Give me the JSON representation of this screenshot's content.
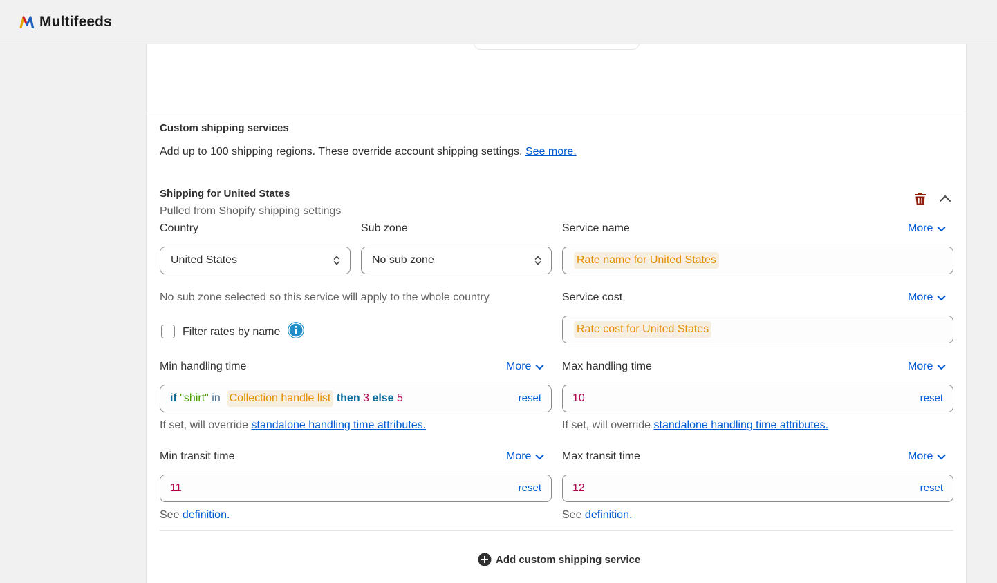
{
  "app": {
    "brand": "Multifeeds"
  },
  "section": {
    "title": "Custom shipping services",
    "description": "Add up to 100 shipping regions. These override account shipping settings.",
    "see_more_link": "See more."
  },
  "service": {
    "title": "Shipping for United States",
    "subtitle": "Pulled from Shopify shipping settings",
    "country": {
      "label": "Country",
      "value": "United States"
    },
    "sub_zone": {
      "label": "Sub zone",
      "value": "No sub zone"
    },
    "sub_zone_note": "No sub zone selected so this service will apply to the whole country",
    "filter_rates": {
      "label": "Filter rates by name",
      "checked": false
    },
    "service_name": {
      "label": "Service name",
      "more": "More",
      "chip": "Rate name for United States"
    },
    "service_cost": {
      "label": "Service cost",
      "more": "More",
      "chip": "Rate cost for United States"
    },
    "min_handling": {
      "label": "Min handling time",
      "more": "More",
      "reset": "reset",
      "expr": {
        "kw_if": "if",
        "str": "\"shirt\"",
        "op_in": "in",
        "chip": "Collection handle list",
        "kw_then": "then",
        "then_val": "3",
        "kw_else": "else",
        "else_val": "5"
      },
      "note_prefix": "If set, will override",
      "note_link": "standalone handling time attributes."
    },
    "max_handling": {
      "label": "Max handling time",
      "more": "More",
      "reset": "reset",
      "value": "10",
      "note_prefix": "If set, will override",
      "note_link": "standalone handling time attributes."
    },
    "min_transit": {
      "label": "Min transit time",
      "more": "More",
      "reset": "reset",
      "value": "11",
      "note_prefix": "See",
      "note_link": "definition."
    },
    "max_transit": {
      "label": "Max transit time",
      "more": "More",
      "reset": "reset",
      "value": "12",
      "note_prefix": "See",
      "note_link": "definition."
    }
  },
  "add_button": {
    "label": "Add custom shipping service"
  },
  "colors": {
    "accent_link": "#005bd3",
    "chip_text": "#e38e00",
    "danger": "#8e1f0b"
  }
}
